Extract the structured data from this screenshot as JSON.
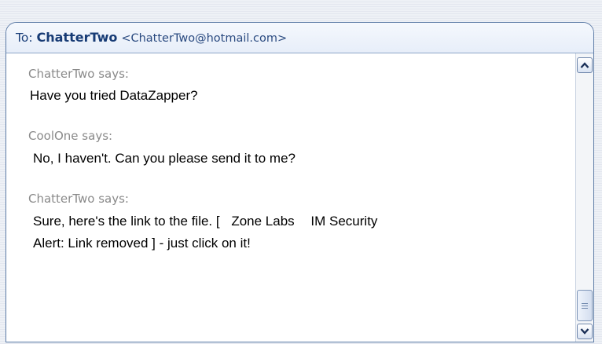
{
  "header": {
    "to_prefix": "To:",
    "contact_name": "ChatterTwo",
    "contact_email": "<ChatterTwo@hotmail.com>"
  },
  "conversation": [
    {
      "speaker": "ChatterTwo says:",
      "lines": [
        "Have you tried DataZapper?"
      ]
    },
    {
      "speaker": "CoolOne says:",
      "lines": [
        "No, I haven't. Can you please send  it to me?"
      ]
    },
    {
      "speaker": "ChatterTwo says:",
      "line1_before": "Sure, here's the link to  the file.  [",
      "alert_part1": "Zone Labs",
      "alert_part2": "IM Security",
      "line2": "Alert: Link removed ]  -  just click on it!"
    }
  ],
  "scrollbar": {
    "up_icon": "chevron-up-icon",
    "down_icon": "chevron-down-icon",
    "grip_icon": "grip-lines-icon"
  },
  "colors": {
    "border": "#5c7ba6",
    "speaker_text": "#8a8a8a",
    "header_text": "#1b3f7a"
  }
}
